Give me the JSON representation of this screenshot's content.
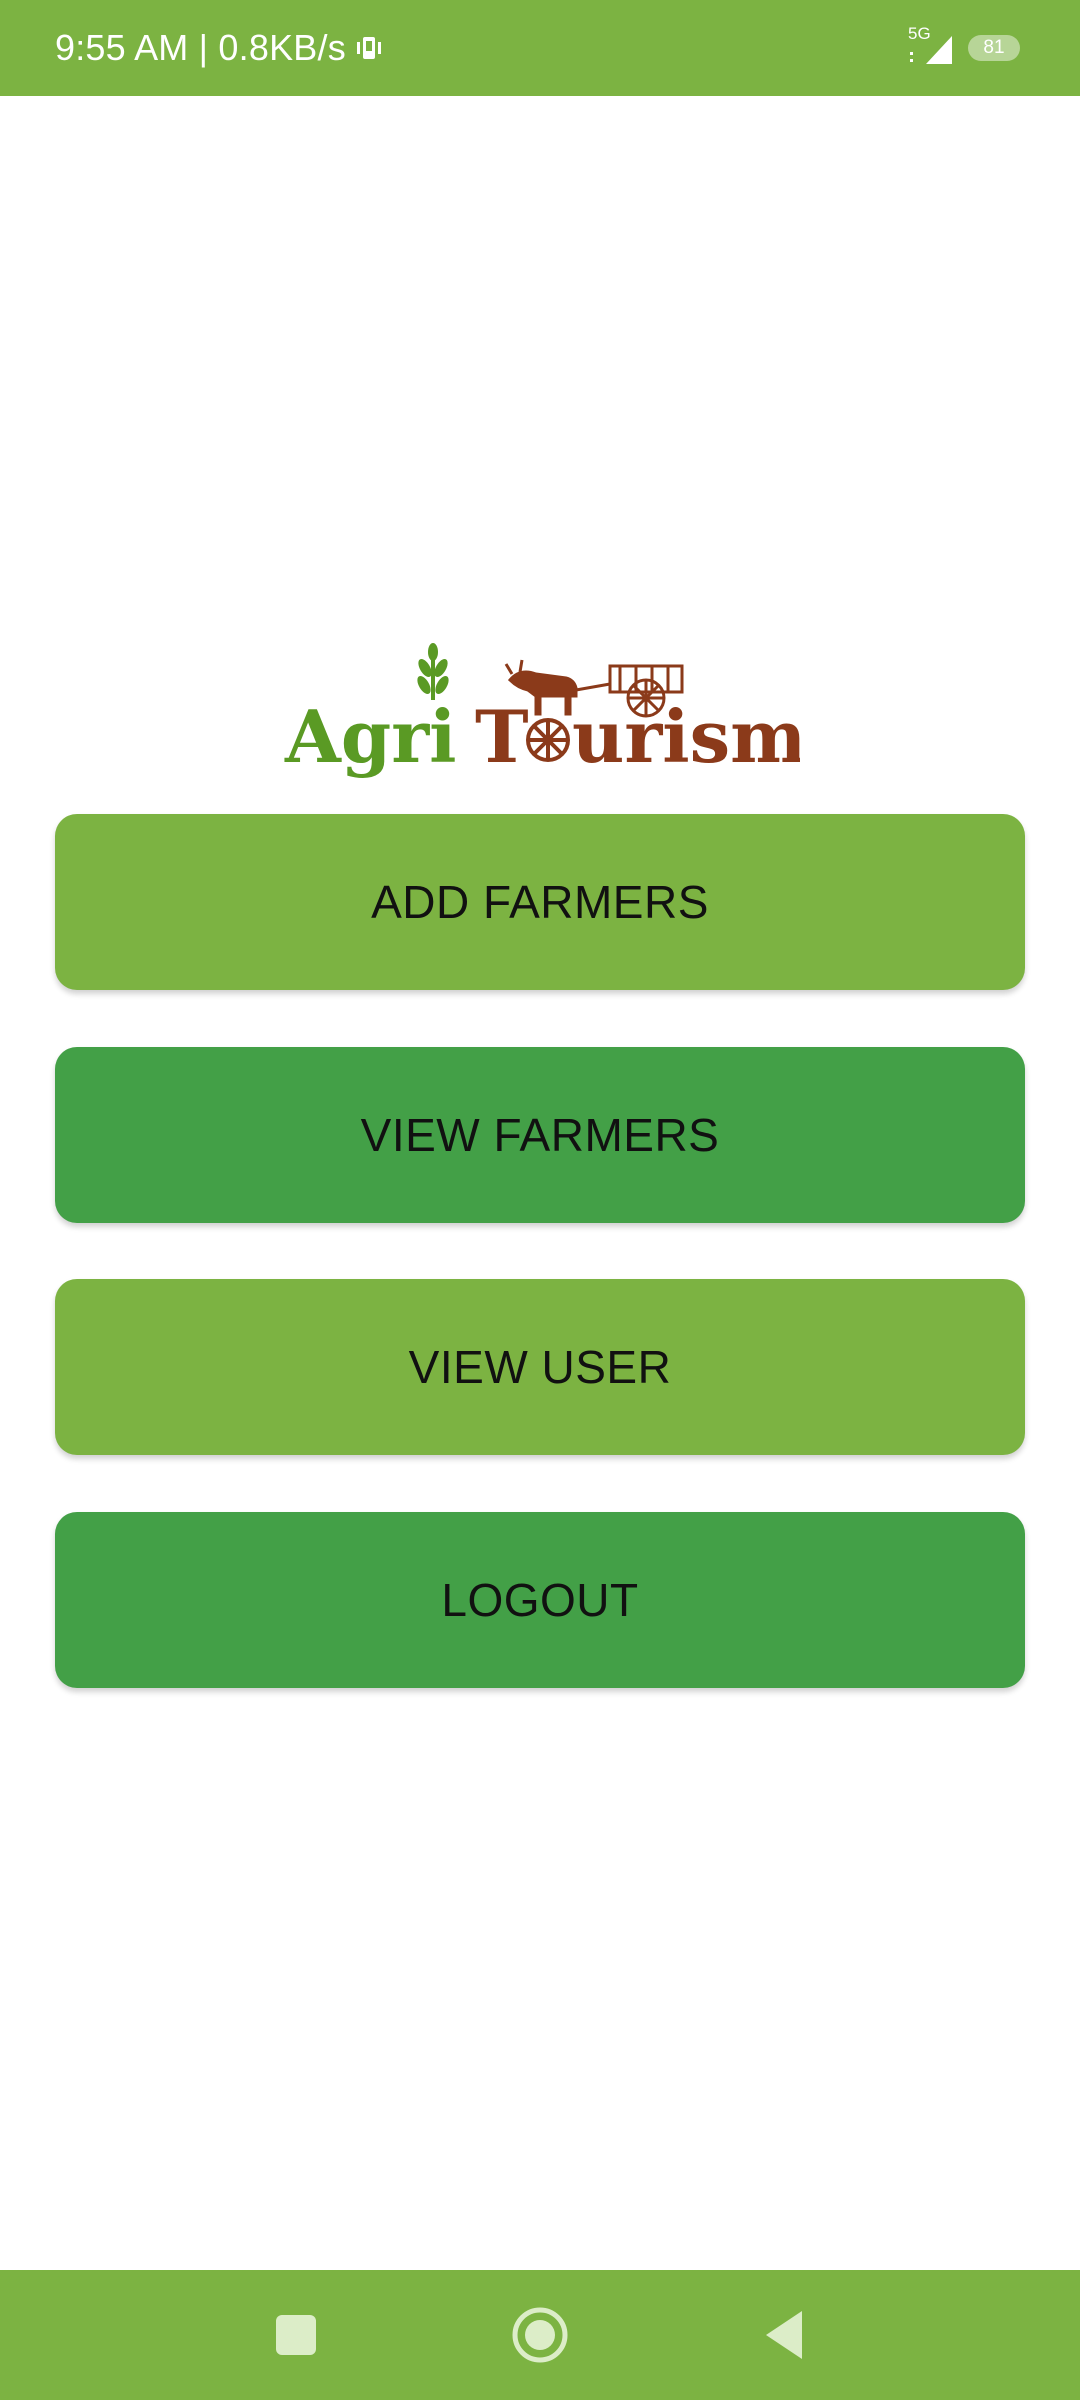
{
  "status_bar": {
    "time_speed": "9:55 AM | 0.8KB/s",
    "network": "5G",
    "battery": "81"
  },
  "logo": {
    "text_left": "Agri",
    "text_right_t": "T",
    "text_right_rest": "urism"
  },
  "menu": {
    "add_farmers": "ADD FARMERS",
    "view_farmers": "VIEW FARMERS",
    "view_user": "VIEW USER",
    "logout": "LOGOUT"
  },
  "colors": {
    "primary": "#7cb342",
    "secondary": "#43a047",
    "logo_green": "#5a9a24",
    "logo_brown": "#8b3a1a"
  },
  "nav_icons": [
    "recents-square-icon",
    "home-circle-icon",
    "back-triangle-icon"
  ]
}
